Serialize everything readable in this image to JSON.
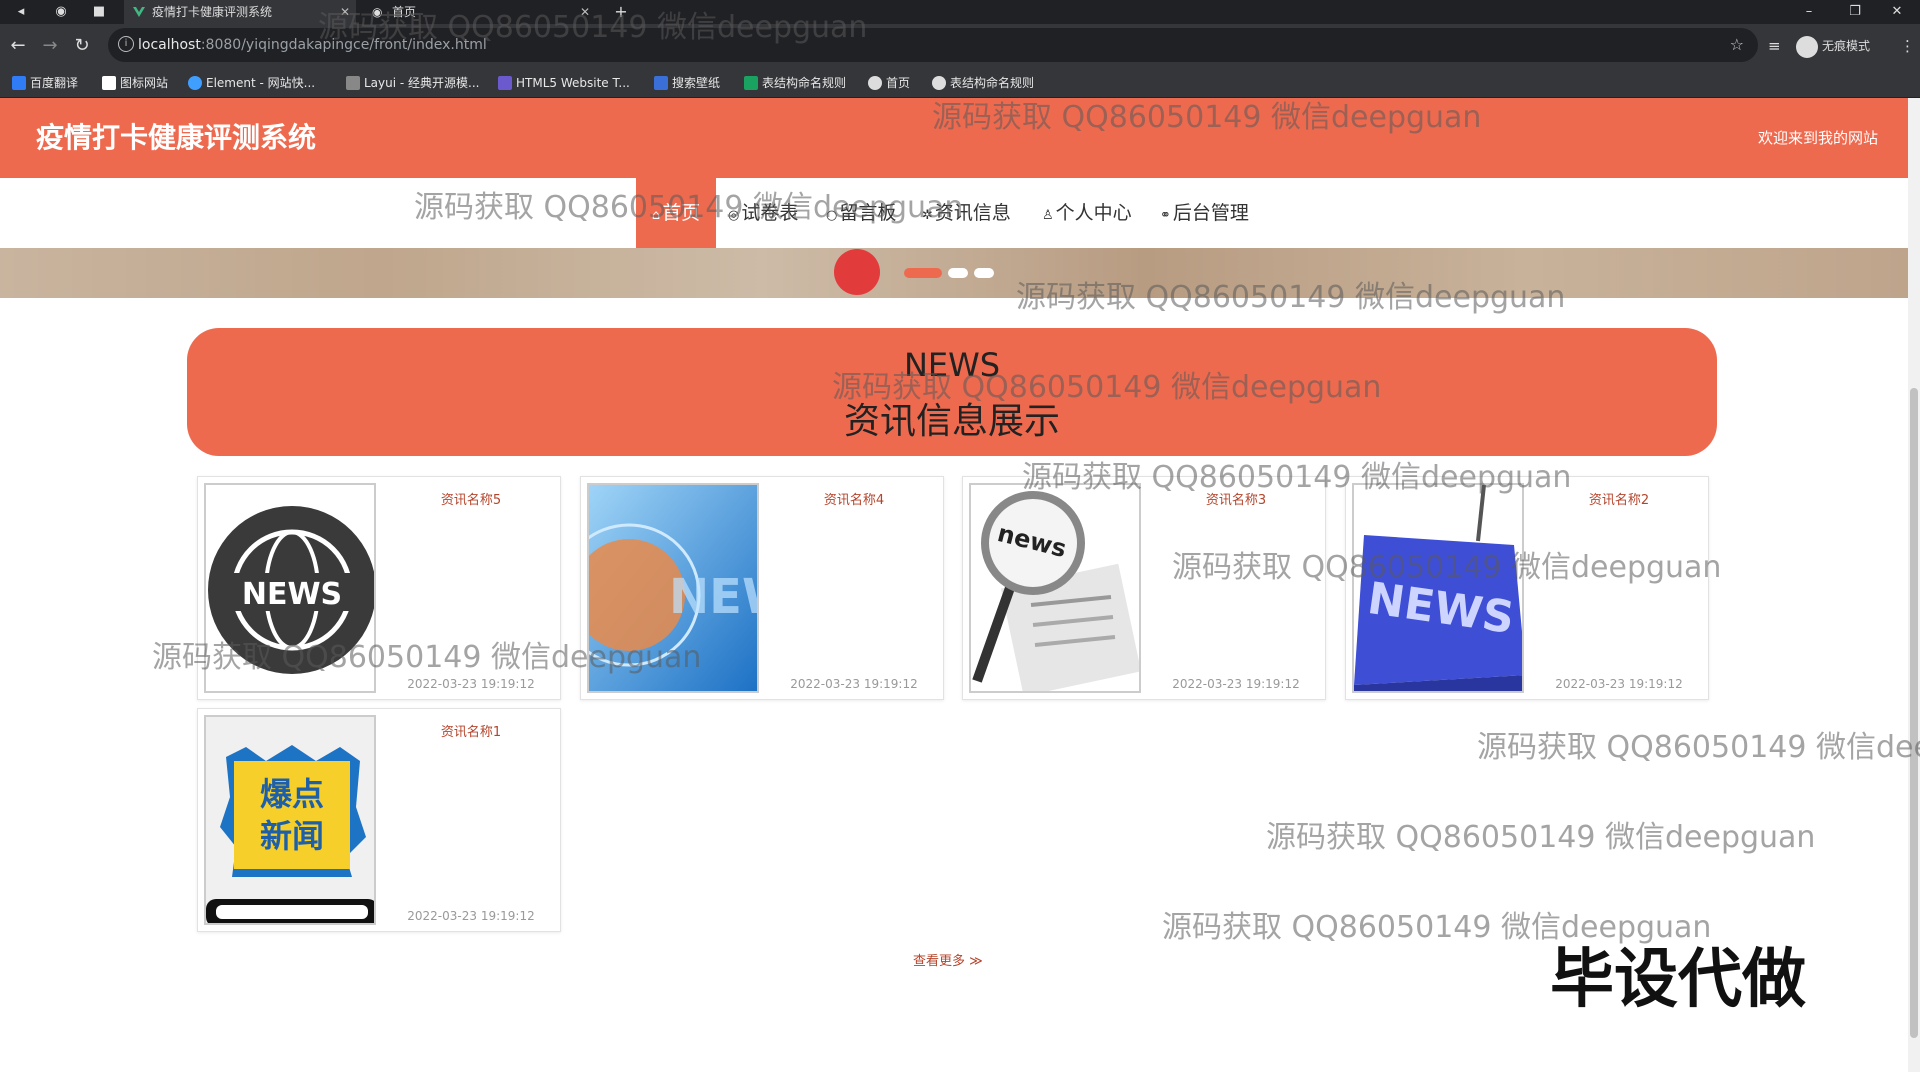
{
  "browser": {
    "tabs": [
      {
        "title": "疫情打卡健康评测系统",
        "active": true
      },
      {
        "title": "首页",
        "active": false
      }
    ],
    "new_tab": "+",
    "url_host": "localhost",
    "url_rest": ":8080/yiqingdakapingce/front/index.html",
    "profile_label": "无痕模式",
    "bookmarks": [
      "百度翻译",
      "图标网站",
      "Element - 网站快...",
      "Layui - 经典开源模...",
      "HTML5 Website T...",
      "搜索壁纸",
      "表结构命名规则",
      "首页",
      "表结构命名规则"
    ]
  },
  "header": {
    "title": "疫情打卡健康评测系统",
    "welcome": "欢迎来到我的网站"
  },
  "nav": [
    {
      "label": "首页",
      "icon": "home-icon",
      "active": true
    },
    {
      "label": "试卷表",
      "icon": "paper-icon",
      "active": false
    },
    {
      "label": "留言板",
      "icon": "message-icon",
      "active": false
    },
    {
      "label": "资讯信息",
      "icon": "info-icon",
      "active": false
    },
    {
      "label": "个人中心",
      "icon": "user-icon",
      "active": false
    },
    {
      "label": "后台管理",
      "icon": "link-icon",
      "active": false
    }
  ],
  "news_section": {
    "title_en": "NEWS",
    "title_cn": "资讯信息展示",
    "more_label": "查看更多 ≫",
    "items": [
      {
        "name": "资讯名称5",
        "time": "2022-03-23 19:19:12",
        "image": "news-globe"
      },
      {
        "name": "资讯名称4",
        "time": "2022-03-23 19:19:12",
        "image": "news-blue-globe"
      },
      {
        "name": "资讯名称3",
        "time": "2022-03-23 19:19:12",
        "image": "news-magnifier"
      },
      {
        "name": "资讯名称2",
        "time": "2022-03-23 19:19:12",
        "image": "news-key"
      },
      {
        "name": "资讯名称1",
        "time": "2022-03-23 19:19:12",
        "image": "news-phone"
      }
    ]
  },
  "watermarks": {
    "text": "源码获取 QQ86050149 微信deepguan",
    "text_cut": "源码获取 QQ86050149 微信dee",
    "big": "毕设代做"
  },
  "colors": {
    "accent": "#ee6a4f",
    "card_title": "#b4452c"
  }
}
